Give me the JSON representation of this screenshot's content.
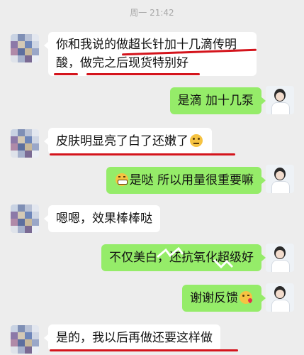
{
  "timestamp": "周一 21:42",
  "messages": [
    {
      "side": "left",
      "lines": [
        "你和我说的做超长针加十几滴传明",
        "酸，做完之后现货特别好"
      ]
    },
    {
      "side": "right",
      "text": "是滴  加十几泵"
    },
    {
      "side": "left",
      "text": "皮肤明显亮了白了还嫩了",
      "emoji": "thinking-face"
    },
    {
      "side": "right",
      "text": "是哒 所以用量很重要嘛",
      "emoji": "grin-face"
    },
    {
      "side": "left",
      "text": "嗯嗯，效果棒棒哒"
    },
    {
      "side": "right",
      "text": "不仅美白，还抗氧化超级好"
    },
    {
      "side": "right",
      "text": "谢谢反馈",
      "emoji": "kiss-face"
    },
    {
      "side": "left",
      "text": "是的，我以后再做还要这样做"
    }
  ],
  "colors": {
    "bubble_right": "#95ec69",
    "bubble_left": "#ffffff",
    "underline": "#d4141c",
    "background": "#ededed"
  }
}
